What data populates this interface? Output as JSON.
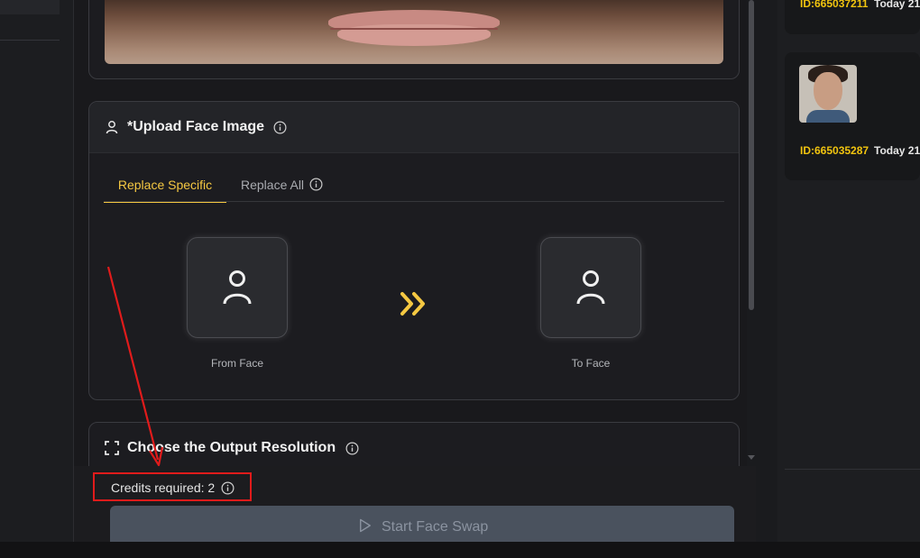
{
  "upload_section": {
    "title": "*Upload Face Image",
    "tabs": [
      {
        "label": "Replace Specific",
        "active": true
      },
      {
        "label": "Replace All",
        "active": false
      }
    ],
    "from_face_label": "From Face",
    "to_face_label": "To Face"
  },
  "resolution_section": {
    "title": "Choose the Output Resolution"
  },
  "credits": {
    "text": "Credits required: 2"
  },
  "start_button": {
    "label": "Start Face Swap"
  },
  "history": [
    {
      "id": "ID:665037211",
      "time": "Today 21"
    },
    {
      "id": "ID:665035287",
      "time": "Today 21"
    }
  ],
  "colors": {
    "accent": "#f5c842",
    "id_text": "#f1c40f",
    "annotation": "#e01b1b",
    "button_bg": "#4a525e"
  },
  "icons": [
    "user-icon",
    "info-icon",
    "double-chevron-right-icon",
    "expand-frame-icon",
    "play-icon"
  ]
}
